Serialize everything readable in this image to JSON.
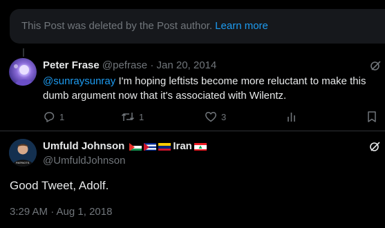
{
  "notice": {
    "text": "This Post was deleted by the Post author.",
    "link": "Learn more"
  },
  "tweet1": {
    "name": "Peter Frase",
    "handle": "@pefrase",
    "separator": "·",
    "date": "Jan 20, 2014",
    "mention": "@sunraysunray",
    "text": " I'm hoping leftists become more reluctant to make this dumb argument now that it's associated with Wilentz.",
    "actions": {
      "reply_count": "1",
      "retweet_count": "1",
      "like_count": "3"
    }
  },
  "tweet2": {
    "name": "Umfuld Johnson",
    "name_suffix": "Iran",
    "handle": "@UmfuldJohnson",
    "text": "Good Tweet, Adolf.",
    "timestamp": "3:29 AM · Aug 1, 2018"
  },
  "colors": {
    "accent": "#1d9bf0",
    "muted": "#71767b",
    "text": "#e7e9ea",
    "background": "#000000"
  },
  "icons": [
    "grok-icon",
    "reply-icon",
    "retweet-icon",
    "like-icon",
    "views-icon",
    "bookmark-icon"
  ]
}
